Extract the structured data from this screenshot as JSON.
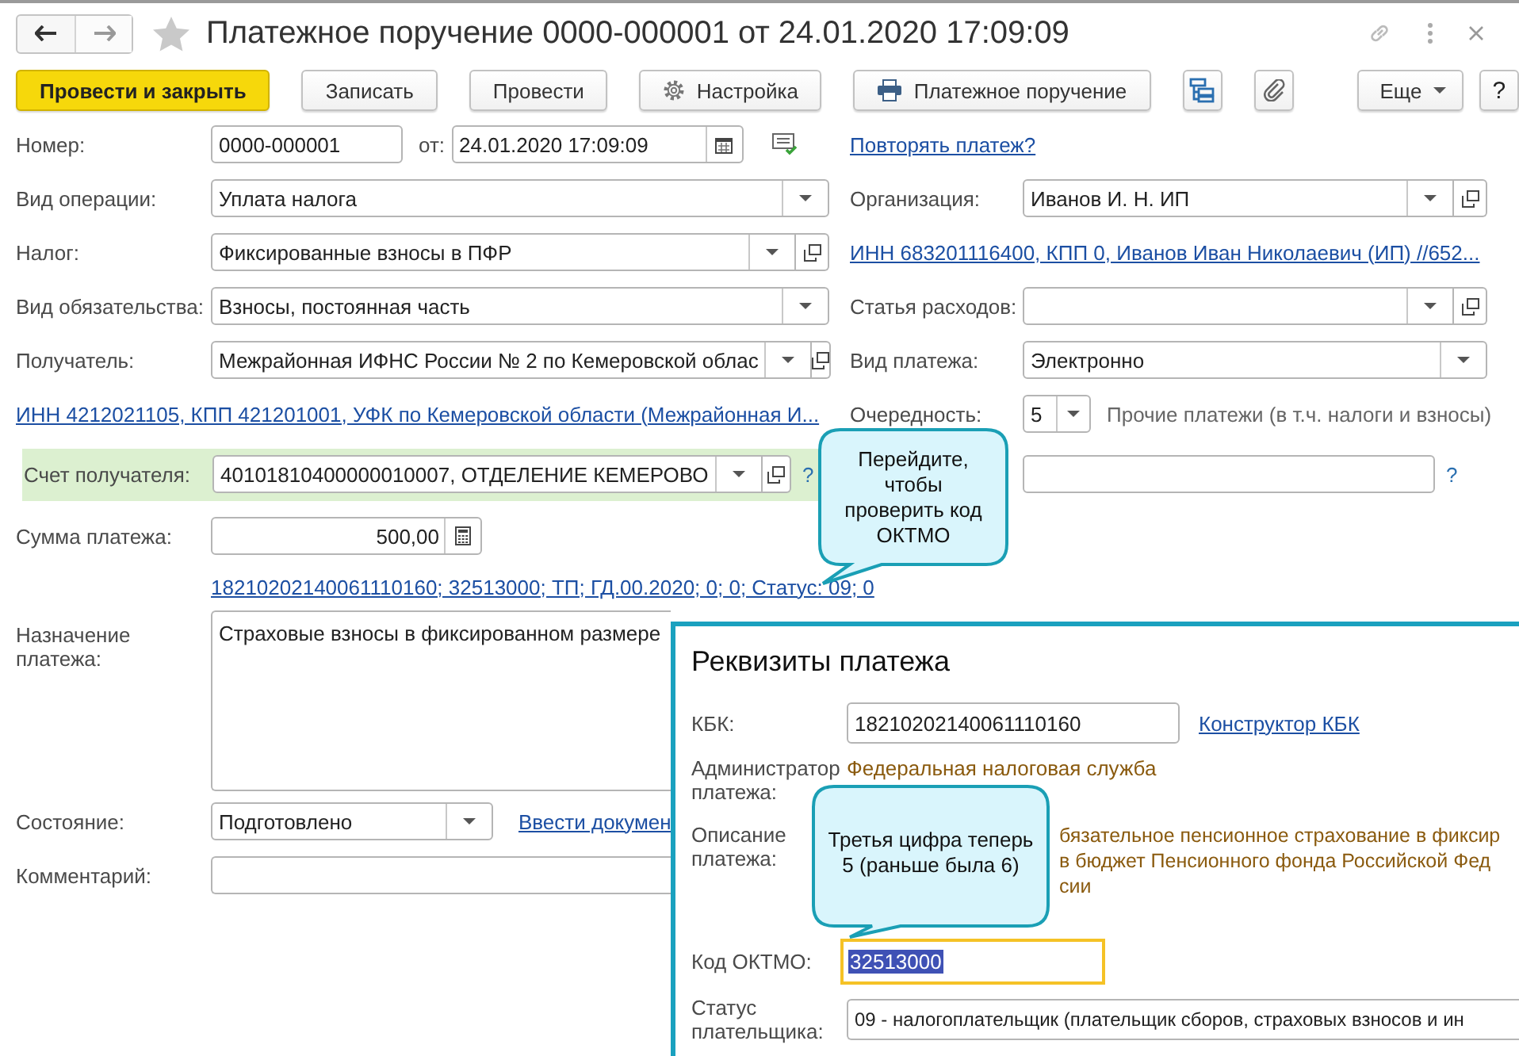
{
  "window": {
    "title": "Платежное поручение 0000-000001 от 24.01.2020 17:09:09"
  },
  "nav": [
    {
      "kind": "back",
      "disabled": false
    },
    {
      "kind": "forward",
      "disabled": true
    }
  ],
  "toolbar": [
    {
      "kind": "primary",
      "label": "Провести и закрыть"
    },
    {
      "kind": "plain",
      "label": "Записать"
    },
    {
      "kind": "plain",
      "label": "Провести"
    },
    {
      "kind": "settings",
      "label": "Настройка"
    },
    {
      "kind": "print",
      "label": "Платежное поручение"
    },
    {
      "kind": "structure"
    },
    {
      "kind": "attach"
    },
    {
      "kind": "more",
      "label": "Еще"
    },
    {
      "kind": "help",
      "label": "?"
    }
  ],
  "number": {
    "label": "Номер:",
    "value": "0000-000001",
    "date_label": "от:",
    "date": "24.01.2020 17:09:09",
    "repeat_link": "Повторять платеж?"
  },
  "rows": [
    {
      "left": {
        "kind": "select",
        "label": "Вид операции:",
        "value": "Уплата налога"
      },
      "right": {
        "kind": "select_open",
        "label": "Организация:",
        "value": "Иванов И. Н. ИП"
      }
    },
    {
      "left": {
        "kind": "select_open",
        "label": "Налог:",
        "value": "Фиксированные взносы в ПФР"
      },
      "right": {
        "kind": "link",
        "text": "ИНН 683201116400, КПП 0, Иванов Иван Николаевич (ИП) //652..."
      }
    },
    {
      "left": {
        "kind": "select",
        "label": "Вид обязательства:",
        "value": "Взносы, постоянная часть"
      },
      "right": {
        "kind": "select_open",
        "label": "Статья расходов:"
      }
    },
    {
      "left": {
        "kind": "select_open",
        "label": "Получатель:",
        "value": "Межрайонная ИФНС России № 2 по Кемеровской облас"
      },
      "right": {
        "kind": "select",
        "label": "Вид платежа:",
        "value": "Электронно"
      }
    },
    {
      "left": {
        "kind": "link",
        "text": "ИНН 4212021105, КПП 421201001, УФК по Кемеровской области (Межрайонная И..."
      },
      "right": {
        "kind": "priority",
        "label": "Очередность:",
        "value": "5",
        "note": "Прочие платежи (в т.ч. налоги и взносы)"
      }
    },
    {
      "left": {
        "kind": "select_open",
        "label": "Счет получателя:",
        "value": "40101810400000010007, ОТДЕЛЕНИЕ КЕМЕРОВО",
        "highlight": true,
        "help": "?"
      },
      "right": {
        "kind": "text",
        "help": "?"
      }
    },
    {
      "left": {
        "kind": "calc",
        "label": "Сумма платежа:",
        "value": "500,00"
      }
    },
    {
      "left": {
        "kind": "link",
        "text": "18210202140061110160; 32513000; ТП; ГД.00.2020; 0; 0; Статус: 09; 0"
      }
    }
  ],
  "purpose": {
    "label": "Назначение платежа:",
    "value": "Страховые взносы в фиксированном размере"
  },
  "state": {
    "label": "Состояние:",
    "value": "Подготовлено",
    "link": "Ввести докумен"
  },
  "comment": {
    "label": "Комментарий:"
  },
  "details_panel": {
    "title": "Реквизиты платежа",
    "kbk": {
      "label": "КБК:",
      "value": "18210202140061110160",
      "link": "Конструктор КБК"
    },
    "administrator": {
      "label": "Администратор платежа:",
      "value": "Федеральная налоговая служба"
    },
    "description": {
      "label": "Описание платежа:",
      "lines": [
        "бязательное пенсионное страхование в фиксир",
        "в бюджет Пенсионного фонда Российской Фед",
        "сии"
      ]
    },
    "oktmo": {
      "label": "Код ОКТМО:",
      "value": "32513000",
      "focused": true,
      "text_selected": true
    },
    "payer_status": {
      "label": "Статус плательщика:",
      "value": "09 - налогоплательщик (плательщик сборов, страховых взносов и ин"
    }
  },
  "callouts": [
    {
      "text": "Перейдите, чтобы проверить код ОКТМО"
    },
    {
      "text": "Третья цифра теперь 5 (раньше была 6)"
    }
  ]
}
